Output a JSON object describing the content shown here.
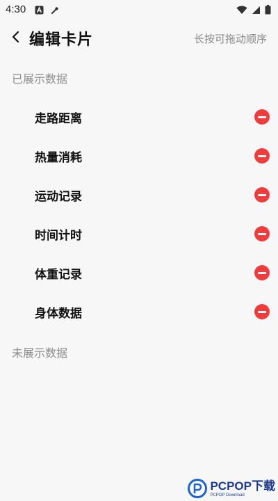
{
  "status_bar": {
    "time": "4:30",
    "icons_left": [
      "a-badge-icon",
      "tool-icon"
    ],
    "icons_right": [
      "wifi-icon",
      "signal-icon",
      "battery-icon"
    ]
  },
  "header": {
    "back_icon": "chevron-left-icon",
    "title": "编辑卡片",
    "action": "长按可拖动顺序"
  },
  "shown_section": {
    "title": "已展示数据",
    "items": [
      {
        "label": "走路距离"
      },
      {
        "label": "热量消耗"
      },
      {
        "label": "运动记录"
      },
      {
        "label": "时间计时"
      },
      {
        "label": "体重记录"
      },
      {
        "label": "身体数据"
      }
    ]
  },
  "hidden_section": {
    "title": "未展示数据"
  },
  "watermark": {
    "main": "PCPOP下载",
    "sub": "PCPOP Download"
  },
  "colors": {
    "remove": "#f23c3c",
    "background": "#f7f7f7",
    "section_title": "#8e8e8e",
    "watermark": "#1b3a8f"
  }
}
